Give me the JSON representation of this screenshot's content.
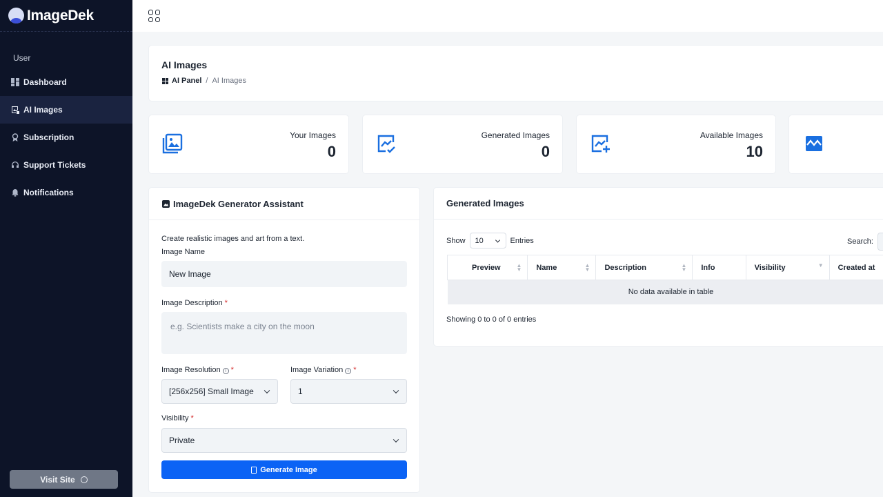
{
  "app": {
    "name": "ImageDek"
  },
  "sidebar": {
    "section_label": "User",
    "items": [
      {
        "label": "Dashboard",
        "icon": "dashboard-icon",
        "active": false
      },
      {
        "label": "AI Images",
        "icon": "ai-images-icon",
        "active": true
      },
      {
        "label": "Subscription",
        "icon": "award-icon",
        "active": false
      },
      {
        "label": "Support Tickets",
        "icon": "headset-icon",
        "active": false
      },
      {
        "label": "Notifications",
        "icon": "bell-icon",
        "active": false
      }
    ],
    "visit_site_label": "Visit Site"
  },
  "page": {
    "title": "AI Images",
    "breadcrumb": {
      "home": "AI Panel",
      "separator": "/",
      "current": "AI Images"
    }
  },
  "stats": [
    {
      "label": "Your Images",
      "value": "0",
      "icon": "images-icon"
    },
    {
      "label": "Generated Images",
      "value": "0",
      "icon": "image-check-icon"
    },
    {
      "label": "Available Images",
      "value": "10",
      "icon": "image-plus-icon"
    },
    {
      "label": "",
      "value": "",
      "icon": "wave-image-icon"
    }
  ],
  "generator": {
    "title": "ImageDek Generator Assistant",
    "intro": "Create realistic images and art from a text.",
    "image_name_label": "Image Name",
    "image_name_value": "New Image",
    "description_label": "Image Description",
    "description_placeholder": "e.g. Scientists make a city on the moon",
    "resolution_label": "Image Resolution",
    "resolution_value": "[256x256] Small Image",
    "variation_label": "Image Variation",
    "variation_value": "1",
    "visibility_label": "Visibility",
    "visibility_value": "Private",
    "required_mark": "*",
    "button_label": "Generate Image"
  },
  "table": {
    "title": "Generated Images",
    "show_label": "Show",
    "length_value": "10",
    "entries_label": "Entries",
    "search_label": "Search:",
    "columns": [
      "Preview",
      "Name",
      "Description",
      "Info",
      "Visibility",
      "Created at"
    ],
    "empty_text": "No data available in table",
    "info_text": "Showing 0 to 0 of 0 entries"
  },
  "colors": {
    "sidebar_bg": "#0d1428",
    "primary": "#0b63f5",
    "icon_blue": "#1a6fe0"
  }
}
